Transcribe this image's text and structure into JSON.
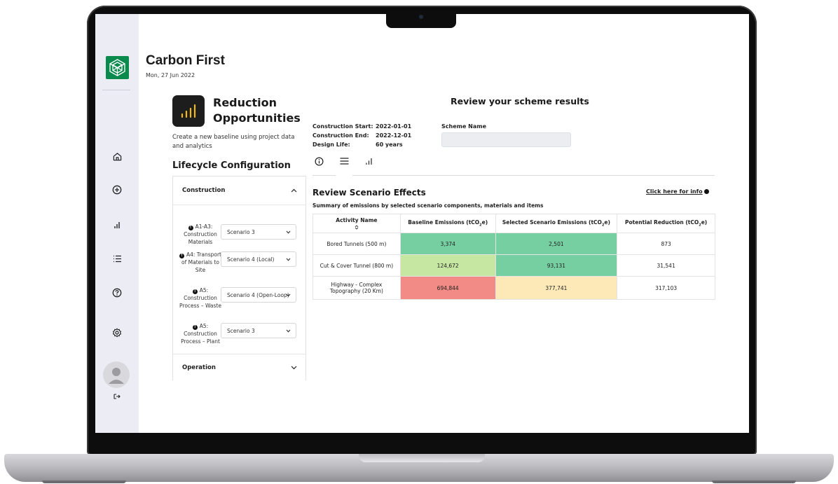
{
  "app": {
    "title": "Carbon First",
    "date": "Mon, 27 Jun 2022"
  },
  "sidebar": {
    "items": [
      {
        "icon": "home-icon"
      },
      {
        "icon": "add-circle-icon"
      },
      {
        "icon": "bar-chart-icon"
      },
      {
        "icon": "list-icon"
      },
      {
        "icon": "help-icon"
      },
      {
        "icon": "settings-icon"
      }
    ],
    "user_icon": "avatar-icon",
    "logout_icon": "logout-icon"
  },
  "tool": {
    "title_line1": "Reduction",
    "title_line2": "Opportunities",
    "description": "Create a new baseline using project data and analytics",
    "icon_color": "#f3b816"
  },
  "lifecycle": {
    "title": "Lifecycle Configuration",
    "sections": [
      {
        "name": "Construction",
        "expanded": true,
        "rows": [
          {
            "label": "A1-A3: Construction Materials",
            "value": "Scenario 3"
          },
          {
            "label": "A4: Transport of Materials to Site",
            "value": "Scenario 4 (Local)"
          },
          {
            "label": "A5: Construction Process – Waste",
            "value": "Scenario 4 (Open-Loop)"
          },
          {
            "label": "A5: Construction Process – Plant",
            "value": "Scenario 3"
          }
        ]
      },
      {
        "name": "Operation",
        "expanded": false
      }
    ]
  },
  "review": {
    "title": "Review your scheme results",
    "meta": [
      {
        "key": "Construction Start:",
        "value": "2022-01-01"
      },
      {
        "key": "Construction End:",
        "value": "2022-12-01"
      },
      {
        "key": "Design Life:",
        "value": "60 years"
      }
    ],
    "scheme_name_label": "Scheme Name",
    "scheme_name_value": "",
    "tabs": [
      "info-icon",
      "list-icon",
      "bar-chart-icon"
    ],
    "active_tab": 1
  },
  "effects": {
    "title": "Review Scenario Effects",
    "subtitle": "Summary of emissions by selected scenario components, materials and items",
    "info_link": "Click here for info",
    "columns": [
      "Activity Name",
      "Baseline Emissions (tCO2e)",
      "Selected Scenario Emissions (tCO2e)",
      "Potential Reduction (tCO2e)"
    ],
    "rows": [
      {
        "activity": "Bored Tunnels (500 m)",
        "baseline": "3,374",
        "scenario": "2,501",
        "reduction": "873",
        "baseline_color": "#76cfa1",
        "scenario_color": "#76cfa1"
      },
      {
        "activity": "Cut & Cover Tunnel (800 m)",
        "baseline": "124,672",
        "scenario": "93,131",
        "reduction": "31,541",
        "baseline_color": "#c6e7a2",
        "scenario_color": "#76cfa1"
      },
      {
        "activity": "Highway - Complex Topography (20 Km)",
        "baseline": "694,844",
        "scenario": "377,741",
        "reduction": "317,103",
        "baseline_color": "#f28b85",
        "scenario_color": "#fde9b8"
      }
    ]
  }
}
